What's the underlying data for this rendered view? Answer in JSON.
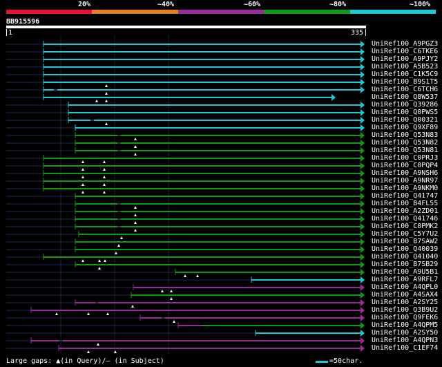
{
  "legend": {
    "labels": [
      "20%",
      "~40%",
      "~60%",
      "~80%",
      "~100%"
    ],
    "colors": [
      "#e8102e",
      "#e6821e",
      "#9b2a9b",
      "#139a13",
      "#1ec8d6"
    ]
  },
  "query": {
    "name": "BB915596",
    "start": "1",
    "end": "335"
  },
  "hits": [
    {
      "label": "UniRef100_A9PGZ3",
      "color": "#1ec8d6",
      "start": 63,
      "end": 522,
      "tail": 53,
      "marks": [],
      "ticks": []
    },
    {
      "label": "UniRef100_C6TKE6",
      "color": "#1ec8d6",
      "start": 63,
      "end": 522,
      "tail": 53,
      "marks": [],
      "ticks": []
    },
    {
      "label": "UniRef100_A9PJY2",
      "color": "#1ec8d6",
      "start": 63,
      "end": 522,
      "tail": 53,
      "marks": [],
      "ticks": []
    },
    {
      "label": "UniRef100_A5B523",
      "color": "#1ec8d6",
      "start": 63,
      "end": 522,
      "tail": 53,
      "marks": [],
      "ticks": []
    },
    {
      "label": "UniRef100_C1K5C9",
      "color": "#1ec8d6",
      "start": 63,
      "end": 522,
      "tail": 53,
      "marks": [],
      "ticks": []
    },
    {
      "label": "UniRef100_B9S1T5",
      "color": "#1ec8d6",
      "start": 63,
      "end": 522,
      "tail": 53,
      "marks": [
        154
      ],
      "ticks": []
    },
    {
      "label": "UniRef100_C6TCH6",
      "color": "#1ec8d6",
      "start": 63,
      "end": 522,
      "tail": 53,
      "marks": [
        154
      ],
      "ticks": [
        80
      ]
    },
    {
      "label": "UniRef100_Q8W537",
      "color": "#1ec8d6",
      "start": 63,
      "end": 480,
      "tail": 53,
      "marks": [
        140,
        154
      ],
      "ticks": []
    },
    {
      "label": "UniRef100_Q39286",
      "color": "#1ec8d6",
      "start": 99,
      "end": 522,
      "tail": 89,
      "marks": [],
      "ticks": []
    },
    {
      "label": "UniRef100_Q0PWS5",
      "color": "#1ec8d6",
      "start": 99,
      "end": 522,
      "tail": 89,
      "marks": [],
      "ticks": []
    },
    {
      "label": "UniRef100_Q00321",
      "color": "#1ec8d6",
      "start": 99,
      "end": 522,
      "tail": 89,
      "marks": [
        154
      ],
      "ticks": [
        133
      ]
    },
    {
      "label": "UniRef100_Q9XF89",
      "color": "#1ec8d6",
      "start": 109,
      "end": 522,
      "tail": 99,
      "marks": [],
      "ticks": []
    },
    {
      "label": "UniRef100_Q53N83",
      "color": "#139a13",
      "start": 109,
      "end": 522,
      "tail": 99,
      "marks": [
        196
      ],
      "ticks": [
        172
      ]
    },
    {
      "label": "UniRef100_Q53N82",
      "color": "#139a13",
      "start": 109,
      "end": 522,
      "tail": 99,
      "marks": [
        196
      ],
      "ticks": [
        172
      ]
    },
    {
      "label": "UniRef100_Q53N81",
      "color": "#139a13",
      "start": 109,
      "end": 522,
      "tail": 99,
      "marks": [
        196
      ],
      "ticks": [
        172
      ]
    },
    {
      "label": "UniRef100_C0PRJ3",
      "color": "#139a13",
      "start": 63,
      "end": 522,
      "tail": 53,
      "marks": [
        120,
        151
      ],
      "ticks": []
    },
    {
      "label": "UniRef100_C0PQP4",
      "color": "#139a13",
      "start": 63,
      "end": 522,
      "tail": 53,
      "marks": [
        120,
        151
      ],
      "ticks": []
    },
    {
      "label": "UniRef100_A9NSH6",
      "color": "#139a13",
      "start": 63,
      "end": 522,
      "tail": 53,
      "marks": [
        120,
        151
      ],
      "ticks": []
    },
    {
      "label": "UniRef100_A9NR97",
      "color": "#139a13",
      "start": 63,
      "end": 522,
      "tail": 53,
      "marks": [
        120,
        151
      ],
      "ticks": []
    },
    {
      "label": "UniRef100_A9NKM0",
      "color": "#139a13",
      "start": 63,
      "end": 522,
      "tail": 53,
      "marks": [
        120,
        151
      ],
      "ticks": []
    },
    {
      "label": "UniRef100_Q41747",
      "color": "#139a13",
      "start": 109,
      "end": 522,
      "tail": 99,
      "marks": [],
      "ticks": []
    },
    {
      "label": "UniRef100_B4FL55",
      "color": "#139a13",
      "start": 109,
      "end": 522,
      "tail": 99,
      "marks": [
        196
      ],
      "ticks": [
        172
      ]
    },
    {
      "label": "UniRef100_A2ZD01",
      "color": "#139a13",
      "start": 109,
      "end": 522,
      "tail": 99,
      "marks": [
        196
      ],
      "ticks": [
        172
      ]
    },
    {
      "label": "UniRef100_Q41746",
      "color": "#139a13",
      "start": 109,
      "end": 522,
      "tail": 99,
      "marks": [
        196
      ],
      "ticks": [
        172
      ]
    },
    {
      "label": "UniRef100_C0PMK2",
      "color": "#139a13",
      "start": 109,
      "end": 522,
      "tail": 99,
      "marks": [
        196
      ],
      "ticks": [
        172
      ]
    },
    {
      "label": "UniRef100_C5Y7U2",
      "color": "#139a13",
      "start": 114,
      "end": 522,
      "tail": 104,
      "marks": [
        176
      ],
      "ticks": []
    },
    {
      "label": "UniRef100_B7SAW2",
      "color": "#139a13",
      "start": 109,
      "end": 522,
      "tail": 99,
      "marks": [
        172
      ],
      "ticks": []
    },
    {
      "label": "UniRef100_Q40039",
      "color": "#139a13",
      "start": 109,
      "end": 522,
      "tail": 99,
      "marks": [
        168
      ],
      "ticks": []
    },
    {
      "label": "UniRef100_Q41040",
      "color": "#139a13",
      "start": 63,
      "end": 522,
      "tail": 53,
      "marks": [
        120,
        144,
        152
      ],
      "ticks": []
    },
    {
      "label": "UniRef100_B7SB29",
      "color": "#139a13",
      "start": 109,
      "end": 522,
      "tail": 99,
      "marks": [
        144
      ],
      "ticks": []
    },
    {
      "label": "UniRef100_A9U5B1",
      "color": "#139a13",
      "start": 254,
      "end": 522,
      "tail": 244,
      "marks": [
        268,
        286
      ],
      "ticks": []
    },
    {
      "label": "UniRef100_A9RFL7",
      "color": "#1ec8d6",
      "start": 364,
      "end": 522,
      "tail": 354,
      "marks": [],
      "ticks": []
    },
    {
      "label": "UniRef100_A4QPL0",
      "color": "#9b2a9b",
      "start": 193,
      "end": 522,
      "tail": 183,
      "marks": [
        235,
        248
      ],
      "ticks": []
    },
    {
      "label": "UniRef100_A4SAX4",
      "color": "#139a13",
      "start": 190,
      "end": 522,
      "tail": 180,
      "marks": [
        248
      ],
      "ticks": []
    },
    {
      "label": "UniRef100_A2SY25",
      "color": "#9b2a9b",
      "start": 109,
      "end": 522,
      "tail": 99,
      "marks": [
        192
      ],
      "ticks": [
        140
      ]
    },
    {
      "label": "UniRef100_Q3B9U2",
      "color": "#9b2a9b",
      "start": 45,
      "end": 522,
      "tail": 35,
      "marks": [
        82,
        128,
        156
      ],
      "ticks": []
    },
    {
      "label": "UniRef100_Q9FEK6",
      "color": "#9b2a9b",
      "start": 203,
      "end": 522,
      "tail": 193,
      "marks": [
        252
      ],
      "ticks": [
        236
      ]
    },
    {
      "label": "UniRef100_A4QPM5",
      "color": "#9b2a9b",
      "start": 258,
      "end": 522,
      "tail": 248,
      "marks": [],
      "ticks": [],
      "split": {
        "at": 292,
        "color": "#139a13"
      }
    },
    {
      "label": "UniRef100_A2SY50",
      "color": "#1ec8d6",
      "start": 370,
      "end": 522,
      "tail": 360,
      "marks": [],
      "ticks": []
    },
    {
      "label": "UniRef100_A4QPN3",
      "color": "#9b2a9b",
      "start": 45,
      "end": 522,
      "tail": 35,
      "marks": [
        142
      ],
      "ticks": [
        88
      ]
    },
    {
      "label": "UniRef100_C1EF74",
      "color": "#9b2a9b",
      "start": 85,
      "end": 522,
      "tail": 75,
      "marks": [
        128,
        167
      ],
      "ticks": []
    }
  ],
  "footer": {
    "gaps_text": "Large gaps: ▲(in Query)/– (in Subject)",
    "scale_text": "=50char."
  }
}
